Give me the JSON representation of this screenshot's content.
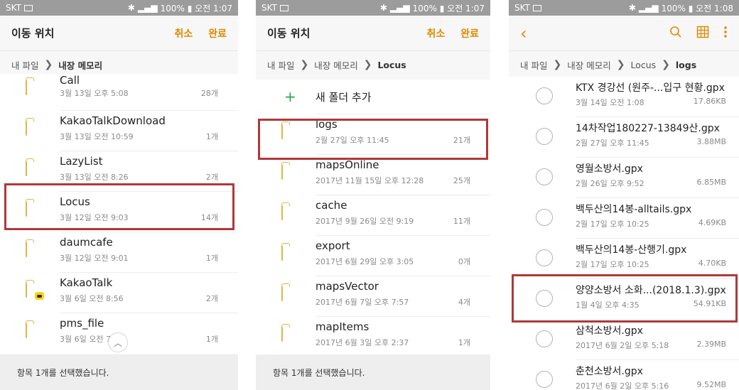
{
  "status": {
    "carrier": "SKT"
  },
  "panel1": {
    "status_time": "100% ▮ 오전 1:07",
    "header": {
      "title": "이동 위치",
      "cancel": "취소",
      "done": "완료"
    },
    "breadcrumb": {
      "root": "내 파일",
      "current": "내장 메모리"
    },
    "items": [
      {
        "name": "Call",
        "date": "3월 13일 오후 5:08",
        "count": "28개"
      },
      {
        "name": "KakaoTalkDownload",
        "date": "3월 13일 오전 10:59",
        "count": "1개"
      },
      {
        "name": "LazyList",
        "date": "3월 13일 오전 8:26",
        "count": "2개"
      },
      {
        "name": "Locus",
        "date": "3월 12일 오전 9:03",
        "count": "14개"
      },
      {
        "name": "daumcafe",
        "date": "3월 12일 오전 9:01",
        "count": "1개"
      },
      {
        "name": "KakaoTalk",
        "date": "3월 6일 오전 8:56",
        "count": "2개"
      },
      {
        "name": "pms_file",
        "date": "3월 6일 오전 7:41",
        "count": "1개"
      }
    ],
    "footer": "항목 1개를 선택했습니다."
  },
  "panel2": {
    "status_time": "100% ▮ 오전 1:07",
    "header": {
      "title": "이동 위치",
      "cancel": "취소",
      "done": "완료"
    },
    "breadcrumb": {
      "root": "내 파일",
      "middle": "내장 메모리",
      "current": "Locus"
    },
    "add_folder": "새 폴더 추가",
    "items": [
      {
        "name": "logs",
        "date": "2월 27일 오후 11:45",
        "count": "21개"
      },
      {
        "name": "mapsOnline",
        "date": "2017년 11월 15일 오후 12:28",
        "count": "25개"
      },
      {
        "name": "cache",
        "date": "2017년 9월 26일 오전 9:19",
        "count": "11개"
      },
      {
        "name": "export",
        "date": "2017년 6월 29일 오후 3:05",
        "count": "0개"
      },
      {
        "name": "mapsVector",
        "date": "2017년 6월 7일 오후 7:57",
        "count": "4개"
      },
      {
        "name": "mapItems",
        "date": "2017년 6월 3일 오후 2:37",
        "count": "1개"
      }
    ],
    "footer": "항목 1개를 선택했습니다."
  },
  "panel3": {
    "status_time": "100% ▮ 오전 1:08",
    "breadcrumb": {
      "root": "내 파일",
      "middle": "내장 메모리",
      "locus": "Locus",
      "current": "logs"
    },
    "items": [
      {
        "name": "KTX 경강선 (원주-...입구 현황.gpx",
        "date": "3월 14일 오전 1:08",
        "size": "17.86KB"
      },
      {
        "name": "14차작업180227-13849산.gpx",
        "date": "2월 27일 오후 11:45",
        "size": "3.88MB"
      },
      {
        "name": "영월소방서.gpx",
        "date": "2월 26일 오후 9:52",
        "size": "6.85MB"
      },
      {
        "name": "백두산의14봉-alltails.gpx",
        "date": "2월 17일 오후 10:25",
        "size": "4.69KB"
      },
      {
        "name": "백두산의14봉-산행기.gpx",
        "date": "2월 17일 오후 10:25",
        "size": "4.70KB"
      },
      {
        "name": "양양소방서 소화...(2018.1.3).gpx",
        "date": "1월 4일 오후 4:35",
        "size": "54.91KB"
      },
      {
        "name": "삼척소방서.gpx",
        "date": "2017년 6월 2일 오후 5:18",
        "size": "2.39MB"
      },
      {
        "name": "춘천소방서.gpx",
        "date": "2017년 6월 2일 오후 5:16",
        "size": "9.52MB"
      }
    ]
  }
}
